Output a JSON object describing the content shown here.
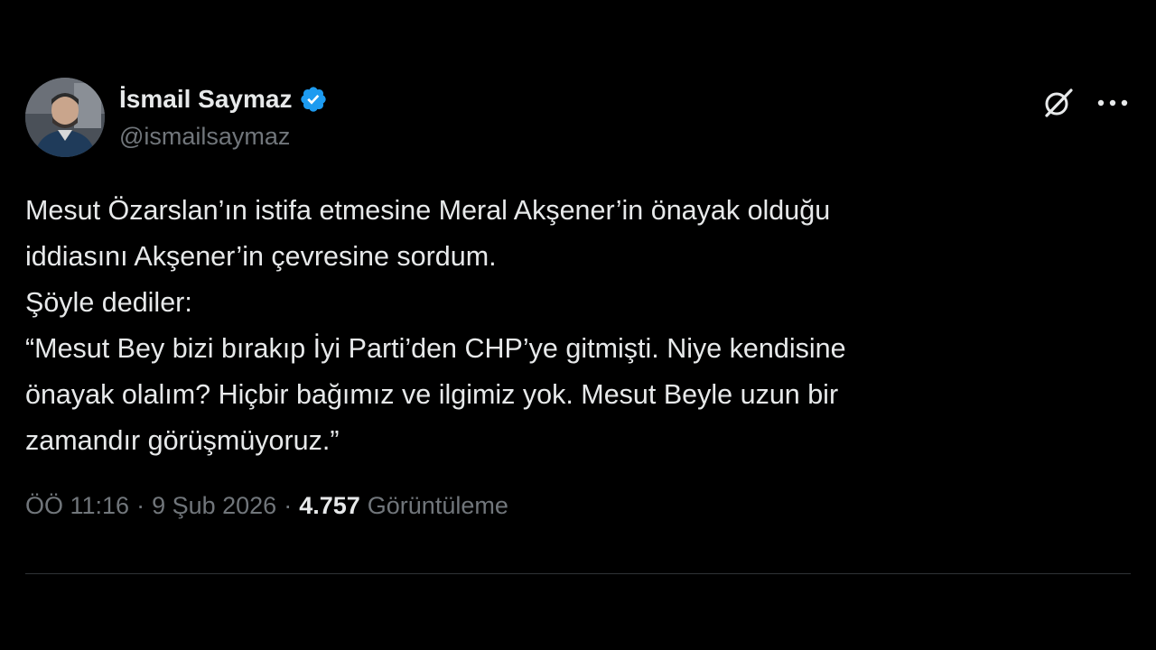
{
  "author": {
    "display_name": "İsmail Saymaz",
    "handle": "@ismailsaymaz",
    "verified_color": "#1d9bf0"
  },
  "actions": {
    "grok_icon": "grok-icon",
    "more_icon": "more-horizontal-icon"
  },
  "tweet": {
    "lines": [
      "Mesut Özarslan’ın istifa etmesine Meral Akşener’in önayak olduğu",
      "iddiasını Akşener’in çevresine sordum.",
      "Şöyle dediler:",
      "“Mesut Bey bizi bırakıp İyi Parti’den CHP’ye gitmişti. Niye kendisine",
      "önayak olalım? Hiçbir bağımız ve ilgimiz yok. Mesut Beyle uzun bir",
      "zamandır görüşmüyoruz.”"
    ]
  },
  "meta": {
    "time": "ÖÖ 11:16",
    "separator": "·",
    "date": "9 Şub 2026",
    "views_count": "4.757",
    "views_label": "Görüntüleme"
  },
  "colors": {
    "background": "#000000",
    "text": "#e7e9ea",
    "secondary": "#71767b",
    "divider": "#2f3336"
  }
}
